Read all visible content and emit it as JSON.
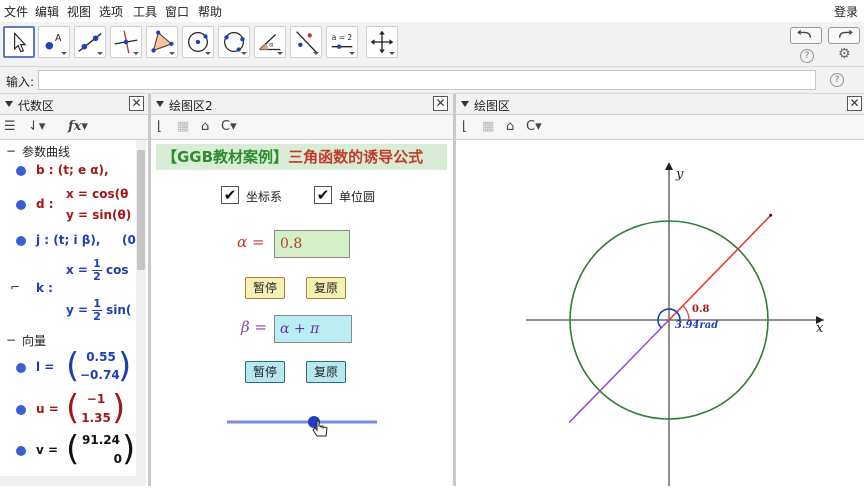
{
  "menu": {
    "items": [
      "文件",
      "编辑",
      "视图",
      "选项",
      "工具",
      "窗口",
      "帮助"
    ],
    "login": "登录"
  },
  "toolbar": {
    "tools": [
      "move-tool-icon",
      "point-tool-icon",
      "line-tool-icon",
      "perpendicular-line-tool-icon",
      "polygon-tool-icon",
      "circle-center-tool-icon",
      "circle-three-points-tool-icon",
      "angle-tool-icon",
      "reflect-tool-icon",
      "slider-tool-icon",
      "move-view-tool-icon"
    ],
    "slider_icon_label": "a = 2",
    "help": "?",
    "settings": "⚙"
  },
  "input": {
    "label": "输入:",
    "value": ""
  },
  "algebra": {
    "title": "代数区",
    "group1": "参数曲线",
    "b": "b : (t; e α),",
    "d_label": "d :",
    "d1": "x = cos(θ",
    "d2": "y = sin(θ)",
    "j": "j : (t; i β),",
    "j_tail": "(0",
    "k_label": "k :",
    "k1_pre": "x =",
    "k1_post": "cos",
    "k2_pre": "y =",
    "k2_post": "sin(",
    "half_num": "1",
    "half_den": "2",
    "group2": "向量",
    "l_label": "l =",
    "l_vals": [
      "0.55",
      "−0.74"
    ],
    "u_label": "u =",
    "u_vals": [
      "−1",
      "1.35"
    ],
    "v_label": "v =",
    "v_vals": [
      "91.24",
      "0"
    ]
  },
  "graphics2": {
    "header": "绘图区2",
    "title_bracket": "【GGB教材案例】",
    "title_text": "三角函数的诱导公式",
    "checkbox_axes": "坐标系",
    "checkbox_unit_circle": "单位圆",
    "axes_checked": true,
    "unit_circle_checked": true,
    "alpha_label": "α =",
    "alpha_value": "0.8",
    "pause1": "暂停",
    "reset1": "复原",
    "beta_label": "β =",
    "beta_value": "α + π",
    "pause2": "暂停",
    "reset2": "复原",
    "slider_fraction": 0.58,
    "colors": {
      "green_title": "#2e8b2e",
      "red_title": "#c0392b",
      "alpha_field": "#d4f0c8",
      "beta_field": "#b8eef4",
      "btn_yellow": "#f6f0b6",
      "btn_cyan": "#b7e8ee"
    }
  },
  "graphics1": {
    "header": "绘图区",
    "axis_x": "x",
    "axis_y": "y",
    "angle_label": "0.8",
    "rad_label": "3.94rad",
    "alpha": 0.8,
    "beta": 3.94,
    "colors": {
      "circle": "#2e7d32",
      "ray_alpha": "#e53935",
      "ray_beta": "#9c4dd6",
      "arc": "#1f3fbf"
    }
  }
}
